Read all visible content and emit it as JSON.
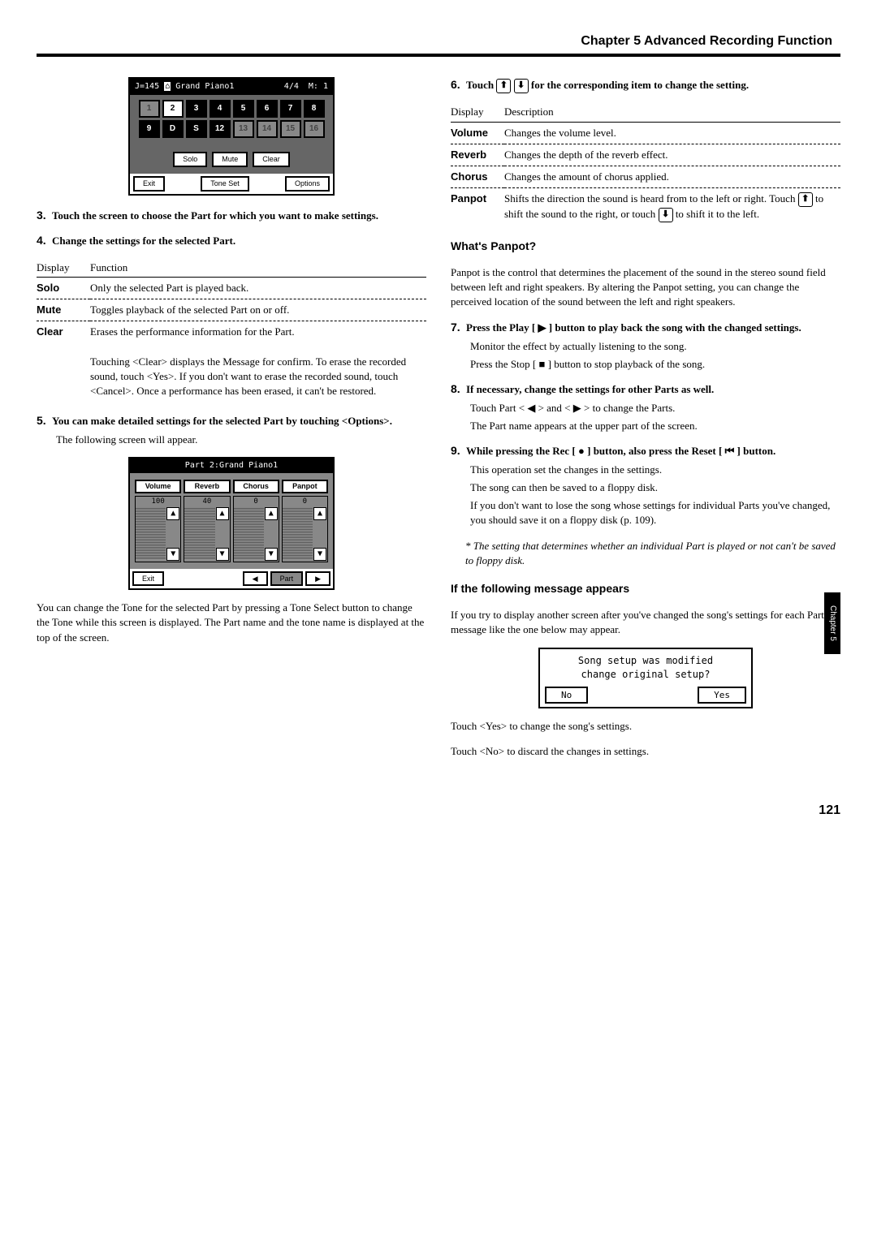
{
  "header": {
    "chapter_title": "Chapter 5 Advanced Recording Function"
  },
  "sideTab": "Chapter 5",
  "pageNumber": "121",
  "screenshot1": {
    "tempo_label": "J=145",
    "tone_name": "Grand Piano1",
    "time_sig": "4/4",
    "measure": "M:  1",
    "row1": [
      "1",
      "2",
      "3",
      "4",
      "5",
      "6",
      "7",
      "8"
    ],
    "row2": [
      "9",
      "D",
      "S",
      "12",
      "13",
      "14",
      "15",
      "16"
    ],
    "btns": {
      "solo": "Solo",
      "mute": "Mute",
      "clear": "Clear"
    },
    "bottom": {
      "exit": "Exit",
      "tone_set": "Tone Set",
      "options": "Options"
    }
  },
  "stepsLeft": {
    "s3": {
      "num": "3.",
      "text": "Touch the screen to choose the Part for which you want to make settings."
    },
    "s4": {
      "num": "4.",
      "text": "Change the settings for the selected Part."
    },
    "table_hdr": {
      "display": "Display",
      "function": "Function"
    },
    "table": {
      "solo_k": "Solo",
      "solo_v": "Only the selected Part is played back.",
      "mute_k": "Mute",
      "mute_v": "Toggles playback of the selected Part on or off.",
      "clear_k": "Clear",
      "clear_v1": "Erases the performance information for the Part.",
      "clear_v2": "Touching <Clear> displays the Message for confirm. To erase the recorded sound, touch <Yes>. If you don't want to erase the recorded sound, touch <Cancel>. Once a performance has been erased, it can't be restored."
    },
    "s5": {
      "num": "5.",
      "text": "You can make detailed settings for the selected Part by touching <Options>.",
      "sub": "The following screen will appear."
    }
  },
  "screenshot2": {
    "title": "Part 2:Grand Piano1",
    "tabs": {
      "volume": "Volume",
      "reverb": "Reverb",
      "chorus": "Chorus",
      "panpot": "Panpot"
    },
    "vals": {
      "volume": "100",
      "reverb": "40",
      "chorus": "0",
      "panpot": "0"
    },
    "bottom": {
      "exit": "Exit",
      "part": "Part"
    }
  },
  "afterSc2": "You can change the Tone for the selected Part by pressing a Tone Select button to change the Tone while this screen is displayed. The Part name and the tone name is displayed at the top of the screen.",
  "stepsRight": {
    "s6": {
      "num": "6.",
      "text_a": "Touch ",
      "text_b": " for the corresponding item to change the setting."
    },
    "table_hdr": {
      "display": "Display",
      "desc": "Description"
    },
    "table": {
      "volume_k": "Volume",
      "volume_v": "Changes the volume level.",
      "reverb_k": "Reverb",
      "reverb_v": "Changes the depth of the reverb effect.",
      "chorus_k": "Chorus",
      "chorus_v": "Changes the amount of chorus applied.",
      "panpot_k": "Panpot",
      "panpot_v1": "Shifts the direction the sound is heard from to the left or right. Touch ",
      "panpot_v2": " to shift the sound to the right, or touch ",
      "panpot_v3": " to shift it to the left."
    },
    "panpot_heading": "What's Panpot?",
    "panpot_para": "Panpot is the control that determines the placement of the sound in the stereo sound field between left and right speakers. By altering the Panpot setting, you can change the perceived location of the sound between the left and right speakers.",
    "s7": {
      "num": "7.",
      "text_a": "Press the Play [ ",
      "text_b": " ] button to play back the song with the changed settings.",
      "sub1": "Monitor the effect by actually listening to the song.",
      "sub2a": "Press the Stop [ ",
      "sub2b": " ] button to stop playback of the song."
    },
    "s8": {
      "num": "8.",
      "text": "If necessary, change the settings for other Parts as well.",
      "sub1a": "Touch Part < ",
      "sub1b": " > and < ",
      "sub1c": " > to change the Parts.",
      "sub2": "The Part name appears at the upper part of the screen."
    },
    "s9": {
      "num": "9.",
      "text_a": "While pressing the Rec [ ",
      "text_b": " ] button, also press the Reset [ ",
      "text_c": " ] button.",
      "sub1": "This operation set the changes in the settings.",
      "sub2": "The song can then be saved to a floppy disk.",
      "sub3": "If you don't want to lose the song whose settings for individual Parts you've changed, you should save it on a floppy disk (p. 109)."
    },
    "footnote": "*  The setting that determines whether an individual Part is played or not can't be saved to floppy disk.",
    "msg_heading": "If the following message appears",
    "msg_para": "If you try to display another screen after you've changed the song's settings for each Part, a message like the one below may appear.",
    "msgbox": {
      "line1": "Song setup was modified",
      "line2": "change original setup?",
      "no": "No",
      "yes": "Yes"
    },
    "after_msg1": "Touch <Yes> to change the song's settings.",
    "after_msg2": "Touch <No> to discard the changes in settings."
  }
}
